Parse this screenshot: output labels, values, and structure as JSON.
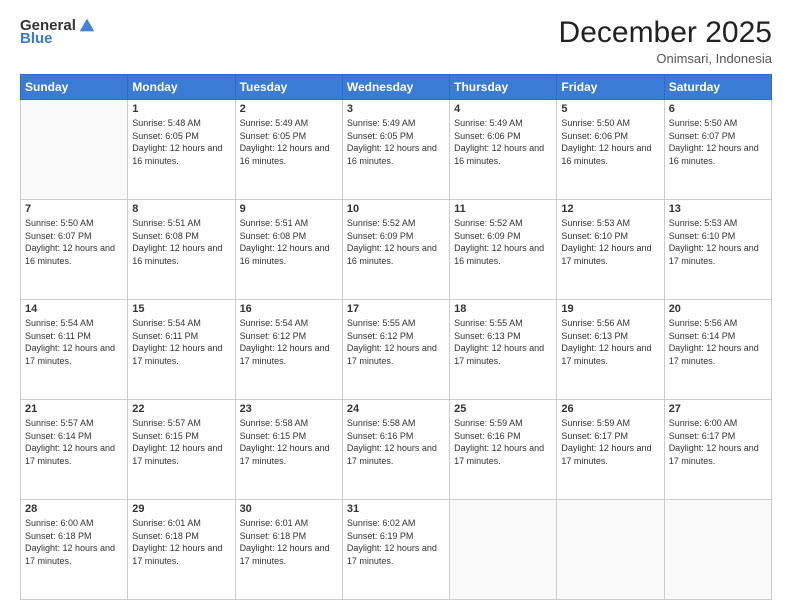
{
  "header": {
    "logo_general": "General",
    "logo_blue": "Blue",
    "title": "December 2025",
    "subtitle": "Onimsari, Indonesia"
  },
  "calendar": {
    "days_of_week": [
      "Sunday",
      "Monday",
      "Tuesday",
      "Wednesday",
      "Thursday",
      "Friday",
      "Saturday"
    ],
    "weeks": [
      [
        {
          "day": "",
          "info": ""
        },
        {
          "day": "1",
          "info": "Sunrise: 5:48 AM\nSunset: 6:05 PM\nDaylight: 12 hours and 16 minutes."
        },
        {
          "day": "2",
          "info": "Sunrise: 5:49 AM\nSunset: 6:05 PM\nDaylight: 12 hours and 16 minutes."
        },
        {
          "day": "3",
          "info": "Sunrise: 5:49 AM\nSunset: 6:05 PM\nDaylight: 12 hours and 16 minutes."
        },
        {
          "day": "4",
          "info": "Sunrise: 5:49 AM\nSunset: 6:06 PM\nDaylight: 12 hours and 16 minutes."
        },
        {
          "day": "5",
          "info": "Sunrise: 5:50 AM\nSunset: 6:06 PM\nDaylight: 12 hours and 16 minutes."
        },
        {
          "day": "6",
          "info": "Sunrise: 5:50 AM\nSunset: 6:07 PM\nDaylight: 12 hours and 16 minutes."
        }
      ],
      [
        {
          "day": "7",
          "info": "Sunrise: 5:50 AM\nSunset: 6:07 PM\nDaylight: 12 hours and 16 minutes."
        },
        {
          "day": "8",
          "info": "Sunrise: 5:51 AM\nSunset: 6:08 PM\nDaylight: 12 hours and 16 minutes."
        },
        {
          "day": "9",
          "info": "Sunrise: 5:51 AM\nSunset: 6:08 PM\nDaylight: 12 hours and 16 minutes."
        },
        {
          "day": "10",
          "info": "Sunrise: 5:52 AM\nSunset: 6:09 PM\nDaylight: 12 hours and 16 minutes."
        },
        {
          "day": "11",
          "info": "Sunrise: 5:52 AM\nSunset: 6:09 PM\nDaylight: 12 hours and 16 minutes."
        },
        {
          "day": "12",
          "info": "Sunrise: 5:53 AM\nSunset: 6:10 PM\nDaylight: 12 hours and 17 minutes."
        },
        {
          "day": "13",
          "info": "Sunrise: 5:53 AM\nSunset: 6:10 PM\nDaylight: 12 hours and 17 minutes."
        }
      ],
      [
        {
          "day": "14",
          "info": "Sunrise: 5:54 AM\nSunset: 6:11 PM\nDaylight: 12 hours and 17 minutes."
        },
        {
          "day": "15",
          "info": "Sunrise: 5:54 AM\nSunset: 6:11 PM\nDaylight: 12 hours and 17 minutes."
        },
        {
          "day": "16",
          "info": "Sunrise: 5:54 AM\nSunset: 6:12 PM\nDaylight: 12 hours and 17 minutes."
        },
        {
          "day": "17",
          "info": "Sunrise: 5:55 AM\nSunset: 6:12 PM\nDaylight: 12 hours and 17 minutes."
        },
        {
          "day": "18",
          "info": "Sunrise: 5:55 AM\nSunset: 6:13 PM\nDaylight: 12 hours and 17 minutes."
        },
        {
          "day": "19",
          "info": "Sunrise: 5:56 AM\nSunset: 6:13 PM\nDaylight: 12 hours and 17 minutes."
        },
        {
          "day": "20",
          "info": "Sunrise: 5:56 AM\nSunset: 6:14 PM\nDaylight: 12 hours and 17 minutes."
        }
      ],
      [
        {
          "day": "21",
          "info": "Sunrise: 5:57 AM\nSunset: 6:14 PM\nDaylight: 12 hours and 17 minutes."
        },
        {
          "day": "22",
          "info": "Sunrise: 5:57 AM\nSunset: 6:15 PM\nDaylight: 12 hours and 17 minutes."
        },
        {
          "day": "23",
          "info": "Sunrise: 5:58 AM\nSunset: 6:15 PM\nDaylight: 12 hours and 17 minutes."
        },
        {
          "day": "24",
          "info": "Sunrise: 5:58 AM\nSunset: 6:16 PM\nDaylight: 12 hours and 17 minutes."
        },
        {
          "day": "25",
          "info": "Sunrise: 5:59 AM\nSunset: 6:16 PM\nDaylight: 12 hours and 17 minutes."
        },
        {
          "day": "26",
          "info": "Sunrise: 5:59 AM\nSunset: 6:17 PM\nDaylight: 12 hours and 17 minutes."
        },
        {
          "day": "27",
          "info": "Sunrise: 6:00 AM\nSunset: 6:17 PM\nDaylight: 12 hours and 17 minutes."
        }
      ],
      [
        {
          "day": "28",
          "info": "Sunrise: 6:00 AM\nSunset: 6:18 PM\nDaylight: 12 hours and 17 minutes."
        },
        {
          "day": "29",
          "info": "Sunrise: 6:01 AM\nSunset: 6:18 PM\nDaylight: 12 hours and 17 minutes."
        },
        {
          "day": "30",
          "info": "Sunrise: 6:01 AM\nSunset: 6:18 PM\nDaylight: 12 hours and 17 minutes."
        },
        {
          "day": "31",
          "info": "Sunrise: 6:02 AM\nSunset: 6:19 PM\nDaylight: 12 hours and 17 minutes."
        },
        {
          "day": "",
          "info": ""
        },
        {
          "day": "",
          "info": ""
        },
        {
          "day": "",
          "info": ""
        }
      ]
    ]
  }
}
